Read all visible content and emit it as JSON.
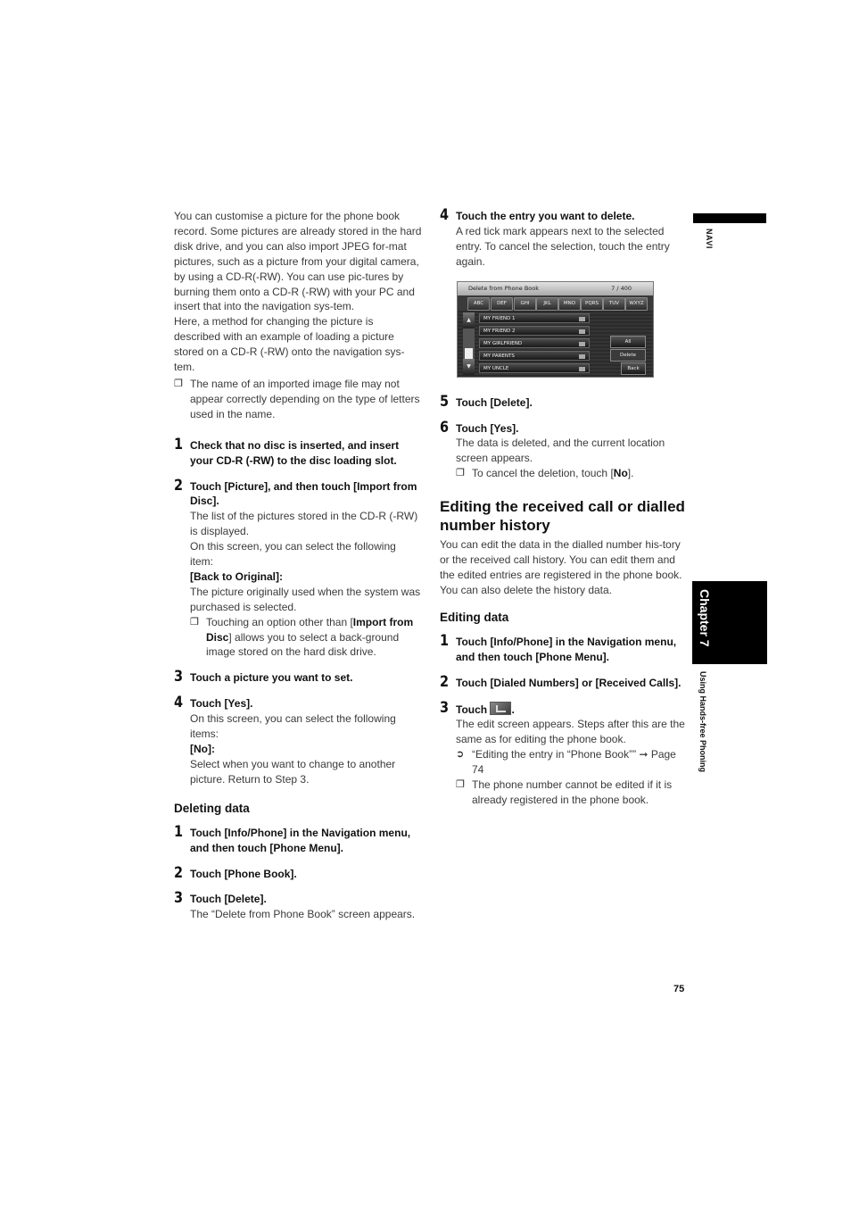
{
  "left_column": {
    "intro_paragraphs": [
      "You can customise a picture for the phone book record. Some pictures are already stored in the hard disk drive, and you can also import JPEG for-mat pictures, such as a picture from your digital camera, by using a CD-R(-RW). You can use pic-tures by burning them onto a CD-R (-RW) with your PC and insert that into the navigation sys-tem.",
      "Here, a method for changing the picture is described with an example of loading a picture stored on a CD-R (-RW) onto the navigation sys-tem."
    ],
    "intro_note": "The name of an imported image file may not appear correctly depending on the type of letters used in the name.",
    "steps": [
      {
        "num": "1",
        "head": "Check that no disc is inserted, and insert your CD-R (-RW) to the disc loading slot."
      },
      {
        "num": "2",
        "head": "Touch [Picture], and then touch [Import from Disc].",
        "body1": "The list of the pictures stored in the CD-R (-RW) is displayed.",
        "body2": "On this screen, you can select the following item:",
        "sub": "[Back to Original]:",
        "body3": "The picture originally used when the system was purchased is selected.",
        "note_pre": "Touching an option other than [",
        "note_bold": "Import from Disc",
        "note_post": "] allows you to select a back-ground image stored on the hard disk drive."
      },
      {
        "num": "3",
        "head": "Touch a picture you want to set."
      },
      {
        "num": "4",
        "head": "Touch [Yes].",
        "body1": "On this screen, you can select the following items:",
        "sub": "[No]:",
        "body2": "Select when you want to change to another picture. Return to Step 3."
      }
    ],
    "deleting": {
      "title": "Deleting data",
      "steps": [
        {
          "num": "1",
          "head": "Touch [Info/Phone] in the Navigation menu, and then touch [Phone Menu]."
        },
        {
          "num": "2",
          "head": "Touch [Phone Book]."
        },
        {
          "num": "3",
          "head": "Touch [Delete].",
          "body": "The “Delete from Phone Book” screen appears."
        }
      ]
    }
  },
  "right_column": {
    "steps_a": [
      {
        "num": "4",
        "head": "Touch the entry you want to delete.",
        "body": "A red tick mark appears next to the selected entry. To cancel the selection, touch the entry again."
      }
    ],
    "screen": {
      "title": "Delete from Phone Book",
      "counter": "7 / 400",
      "tabs": [
        "ABC",
        "DEF",
        "GHI",
        "JKL",
        "MNO",
        "PQRS",
        "TUV",
        "WXYZ"
      ],
      "entries": [
        "MY FRIEND 1",
        "MY FRIEND 2",
        "MY GIRLFRIEND",
        "MY PARENTS",
        "MY UNCLE"
      ],
      "buttons": {
        "all": "All",
        "delete": "Delete",
        "back": "Back"
      }
    },
    "steps_b": [
      {
        "num": "5",
        "head": "Touch [Delete]."
      },
      {
        "num": "6",
        "head": "Touch [Yes].",
        "body": "The data is deleted, and the current location screen appears.",
        "note_pre": "To cancel the deletion, touch [",
        "note_bold": "No",
        "note_post": "]."
      }
    ],
    "editing_section": {
      "title": "Editing the received call or dialled number history",
      "intro": "You can edit the data in the dialled number his-tory or the received call history. You can edit them and the edited entries are registered in the phone book. You can also delete the history data.",
      "subtitle": "Editing data",
      "steps": [
        {
          "num": "1",
          "head": "Touch [Info/Phone] in the Navigation menu, and then touch [Phone Menu]."
        },
        {
          "num": "2",
          "head": "Touch [Dialed Numbers] or [Received Calls]."
        },
        {
          "num": "3",
          "head": "Touch",
          "head_end": ".",
          "icon": "edit-icon",
          "body": "The edit screen appears. Steps after this are the same as for editing the phone book.",
          "ref": "“Editing the entry in “Phone Book”” ➞ Page 74",
          "note": "The phone number cannot be edited if it is already registered in the phone book."
        }
      ]
    }
  },
  "side": {
    "navi": "NAVI",
    "chapter": "Chapter 7",
    "chapter_title": "Using Hands-free Phoning"
  },
  "page_number": "75",
  "glyphs": {
    "note": "❐",
    "ref": "➲"
  }
}
